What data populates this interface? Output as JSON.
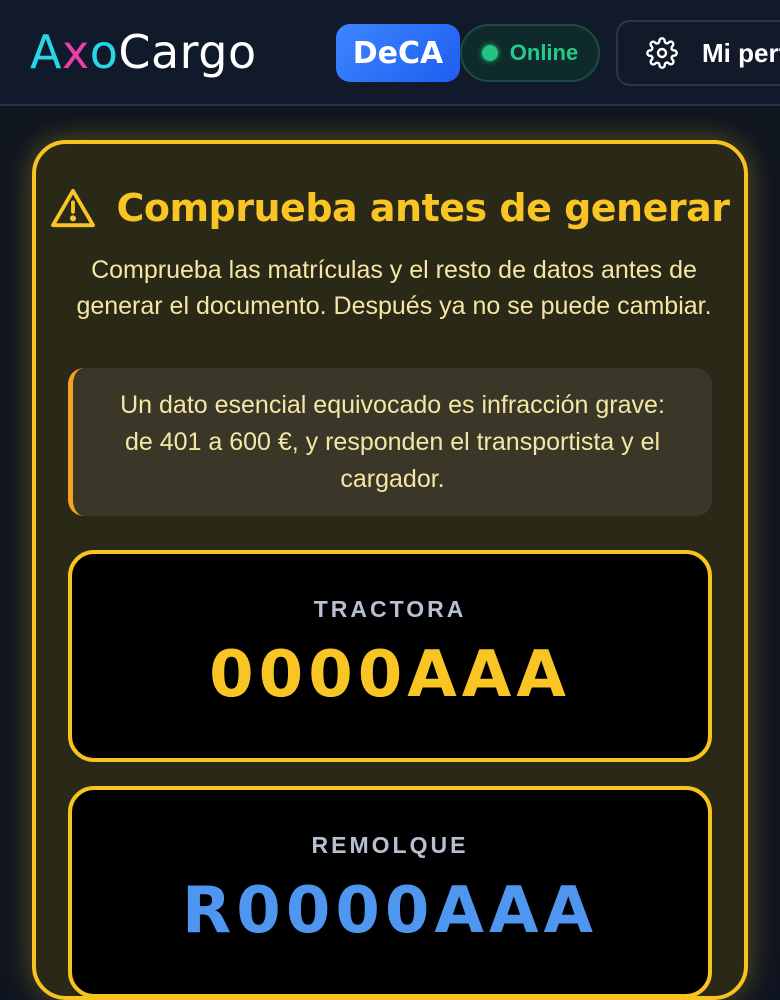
{
  "header": {
    "logo": {
      "a": "A",
      "x": "x",
      "o": "o",
      "rest": "Cargo"
    },
    "app_badge": "DeCA",
    "status": {
      "label": "Online",
      "color": "#22c47f"
    },
    "profile_label": "Mi perfil"
  },
  "warning": {
    "title": "Comprueba antes de generar",
    "description": "Comprueba las matrículas y el resto de datos antes de generar el documento. Después ya no se puede cambiar.",
    "note": "Un dato esencial equivocado es infracción grave: de 401 a 600 €, y responden el transportista y el cargador.",
    "accent_color": "#f7c41f"
  },
  "plates": [
    {
      "label": "TRACTORA",
      "value": "0000AAA",
      "color": "#f8c524"
    },
    {
      "label": "REMOLQUE",
      "value": "R0000AAA",
      "color": "#4f96f0"
    }
  ]
}
